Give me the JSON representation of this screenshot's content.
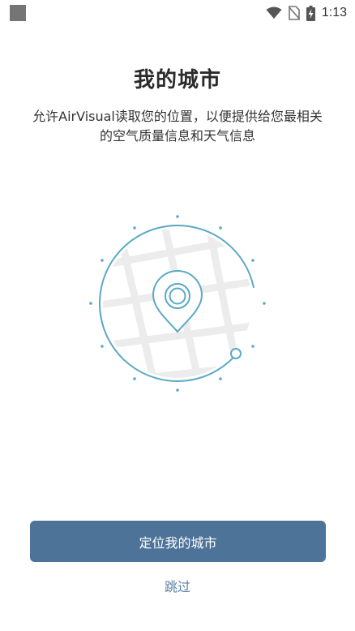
{
  "status_bar": {
    "time": "1:13",
    "icons": [
      "notification-square-icon",
      "wifi-icon",
      "no-sim-icon",
      "battery-charging-icon"
    ]
  },
  "header": {
    "title": "我的城市",
    "description": "允许AirVisual读取您的位置，以便提供给您最相关的空气质量信息和天气信息"
  },
  "illustration": {
    "icon": "location-pin-map-icon",
    "accent_color": "#5aa9c5"
  },
  "actions": {
    "locate_label": "定位我的城市",
    "skip_label": "跳过",
    "primary_color": "#4d7399",
    "link_color": "#5a7ea3"
  }
}
